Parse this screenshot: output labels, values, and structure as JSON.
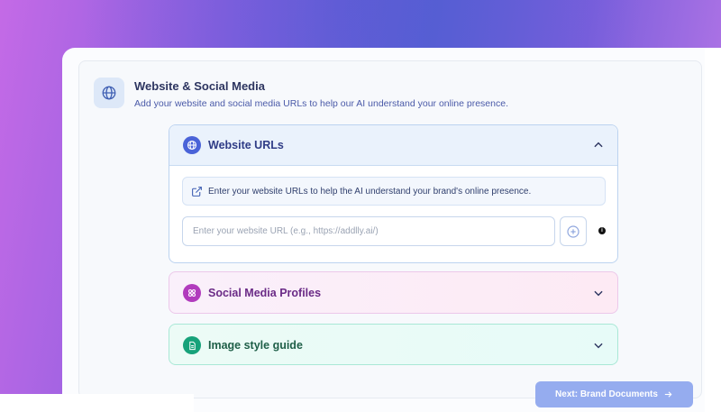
{
  "section": {
    "title": "Website & Social Media",
    "subtitle": "Add your website and social media URLs to help our AI understand your online presence.",
    "icon": "globe-icon"
  },
  "accordions": {
    "website": {
      "title": "Website URLs",
      "icon": "globe-icon",
      "expanded": true,
      "accent": "#4a63d8",
      "info_text": "Enter your website URLs to help the AI understand your brand's online presence.",
      "input_placeholder": "Enter your website URL (e.g., https://addlly.ai/)",
      "input_value": ""
    },
    "social": {
      "title": "Social Media Profiles",
      "icon": "share-icon",
      "expanded": false,
      "accent": "#b13bbd"
    },
    "image": {
      "title": "Image style guide",
      "icon": "document-icon",
      "expanded": false,
      "accent": "#17a27a"
    }
  },
  "footer": {
    "next_label": "Next: Brand Documents",
    "next_icon": "arrow-right-icon"
  },
  "colors": {
    "next_button": "#95acef",
    "title_text": "#2d3560",
    "subtitle_text": "#4a5aa8"
  }
}
